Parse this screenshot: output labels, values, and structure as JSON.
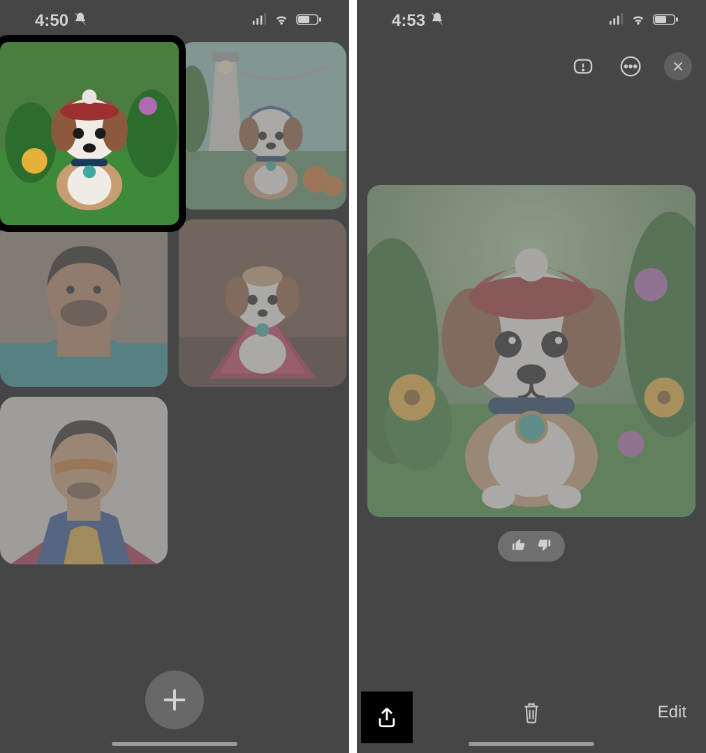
{
  "left": {
    "status_time": "4:50",
    "thumbs": [
      {
        "name": "thumb-dog-garden",
        "alt": "Dog with red cap in garden",
        "selected": true
      },
      {
        "name": "thumb-dog-lighthouse",
        "alt": "Dog near lighthouse",
        "selected": false
      },
      {
        "name": "thumb-man-teal",
        "alt": "Man portrait teal shirt",
        "selected": false
      },
      {
        "name": "thumb-dog-cape",
        "alt": "Dog with superhero cape",
        "selected": false
      },
      {
        "name": "thumb-man-superhero",
        "alt": "Man superhero outfit sunglasses",
        "selected": false
      }
    ],
    "add_label": "Add new"
  },
  "right": {
    "status_time": "4:53",
    "actions": {
      "report_name": "report-icon",
      "more_name": "more-icon",
      "close_name": "close-icon"
    },
    "main_image_alt": "Cartoon dog with red cap sitting in flower garden",
    "feedback": {
      "up": "thumbs-up-icon",
      "down": "thumbs-down-icon"
    },
    "share_label": "Share",
    "delete_label": "Delete",
    "edit_label": "Edit"
  },
  "colors": {
    "dog_red": "#b13a3a",
    "dog_body": "#c79d72",
    "dog_white": "#f0ece5",
    "grass": "#3f8a3a",
    "leaf": "#2c6c2d",
    "flower_y": "#e6b13a",
    "flower_p": "#b06ab3",
    "sky": "#8fbfb9",
    "cape": "#a02d44",
    "lighthouse": "#d7d3cc",
    "skin": "#b37f5d",
    "teal": "#2a8b8f",
    "hero_blue": "#2a4a8f",
    "hero_yel": "#d6a531"
  }
}
